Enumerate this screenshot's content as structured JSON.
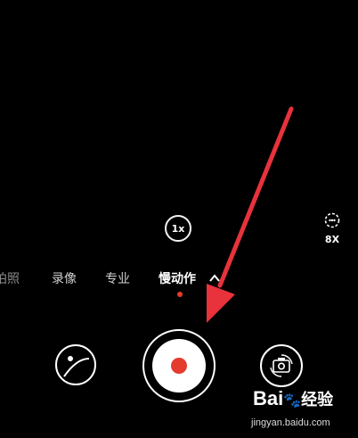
{
  "zoom": {
    "label": "1x"
  },
  "speed": {
    "label": "8X",
    "icon": "slow-motion-speed-icon"
  },
  "modes": [
    {
      "label": "拍照",
      "display": "拍照",
      "active": false
    },
    {
      "label": "录像",
      "active": false
    },
    {
      "label": "专业",
      "active": false
    },
    {
      "label": "慢动作",
      "active": true
    }
  ],
  "controls": {
    "gallery_icon": "gallery-thumbnail-icon",
    "shutter_icon": "record-shutter-icon",
    "switch_icon": "switch-camera-icon",
    "more_icon": "chevron-up-icon"
  },
  "colors": {
    "record": "#e53a2e",
    "arrow": "#e8323c",
    "background": "#000000"
  },
  "watermark": {
    "logo_text": "Bai",
    "logo_suffix": "经验",
    "url": "jingyan.baidu.com"
  }
}
